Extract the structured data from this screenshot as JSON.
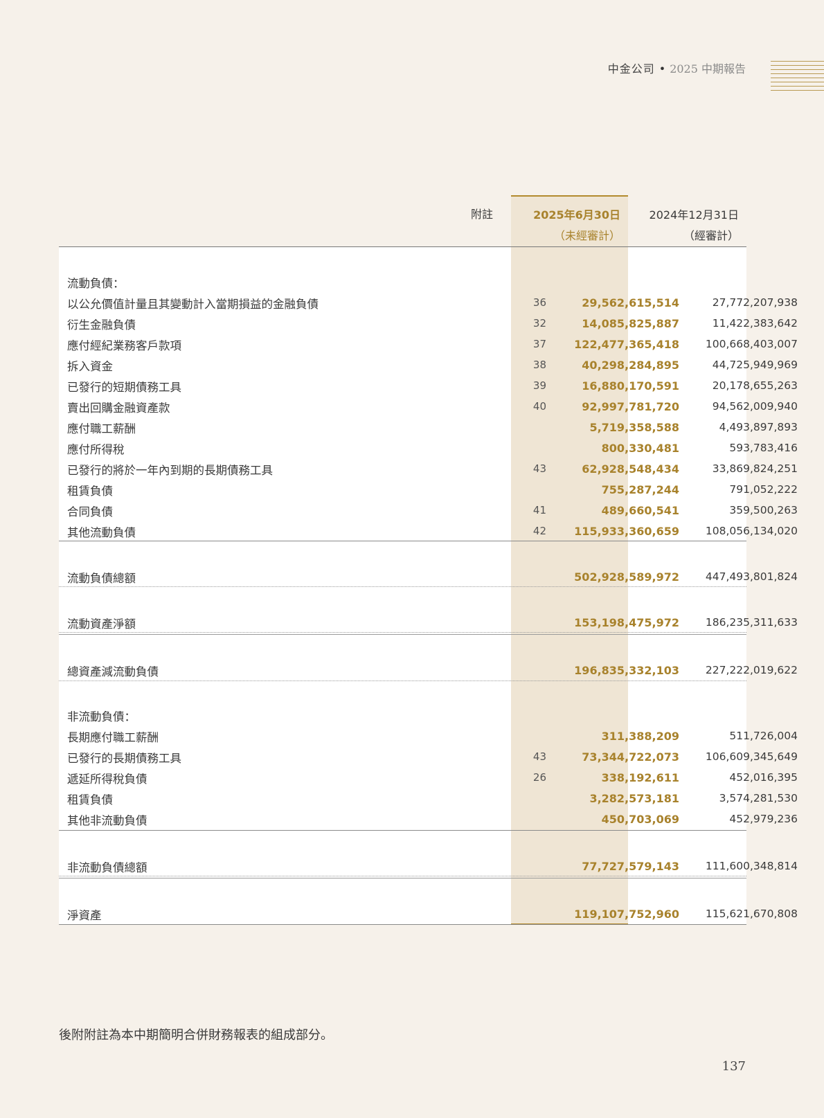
{
  "header": {
    "company": "中金公司",
    "separator": "•",
    "report": "2025 中期報告"
  },
  "columns": {
    "note": "附註",
    "current_date": "2025年6月30日",
    "current_status": "（未經審計）",
    "prior_date": "2024年12月31日",
    "prior_status": "（經審計）"
  },
  "sections": {
    "current_liabilities": "流動負債：",
    "non_current_liabilities": "非流動負債："
  },
  "current_rows": [
    {
      "label": "以公允價值計量且其變動計入當期損益的金融負債",
      "note": "36",
      "current": "29,562,615,514",
      "prior": "27,772,207,938"
    },
    {
      "label": "衍生金融負債",
      "note": "32",
      "current": "14,085,825,887",
      "prior": "11,422,383,642"
    },
    {
      "label": "應付經紀業務客戶款項",
      "note": "37",
      "current": "122,477,365,418",
      "prior": "100,668,403,007"
    },
    {
      "label": "拆入資金",
      "note": "38",
      "current": "40,298,284,895",
      "prior": "44,725,949,969"
    },
    {
      "label": "已發行的短期債務工具",
      "note": "39",
      "current": "16,880,170,591",
      "prior": "20,178,655,263"
    },
    {
      "label": "賣出回購金融資產款",
      "note": "40",
      "current": "92,997,781,720",
      "prior": "94,562,009,940"
    },
    {
      "label": "應付職工薪酬",
      "note": "",
      "current": "5,719,358,588",
      "prior": "4,493,897,893"
    },
    {
      "label": "應付所得稅",
      "note": "",
      "current": "800,330,481",
      "prior": "593,783,416"
    },
    {
      "label": "已發行的將於一年內到期的長期債務工具",
      "note": "43",
      "current": "62,928,548,434",
      "prior": "33,869,824,251"
    },
    {
      "label": "租賃負債",
      "note": "",
      "current": "755,287,244",
      "prior": "791,052,222"
    },
    {
      "label": "合同負債",
      "note": "41",
      "current": "489,660,541",
      "prior": "359,500,263"
    },
    {
      "label": "其他流動負債",
      "note": "42",
      "current": "115,933,360,659",
      "prior": "108,056,134,020"
    }
  ],
  "totals": {
    "current_total": {
      "label": "流動負債總額",
      "current": "502,928,589,972",
      "prior": "447,493,801,824"
    },
    "net_current_assets": {
      "label": "流動資產淨額",
      "current": "153,198,475,972",
      "prior": "186,235,311,633"
    },
    "total_assets_less_current": {
      "label": "總資產減流動負債",
      "current": "196,835,332,103",
      "prior": "227,222,019,622"
    },
    "non_current_total": {
      "label": "非流動負債總額",
      "current": "77,727,579,143",
      "prior": "111,600,348,814"
    },
    "net_assets": {
      "label": "淨資產",
      "current": "119,107,752,960",
      "prior": "115,621,670,808"
    }
  },
  "non_current_rows": [
    {
      "label": "長期應付職工薪酬",
      "note": "",
      "current": "311,388,209",
      "prior": "511,726,004"
    },
    {
      "label": "已發行的長期債務工具",
      "note": "43",
      "current": "73,344,722,073",
      "prior": "106,609,345,649"
    },
    {
      "label": "遞延所得稅負債",
      "note": "26",
      "current": "338,192,611",
      "prior": "452,016,395"
    },
    {
      "label": "租賃負債",
      "note": "",
      "current": "3,282,573,181",
      "prior": "3,574,281,530"
    },
    {
      "label": "其他非流動負債",
      "note": "",
      "current": "450,703,069",
      "prior": "452,979,236"
    }
  ],
  "footnote": "後附附註為本中期簡明合併財務報表的組成部分。",
  "page_number": "137",
  "colors": {
    "background": "#f6f1ea",
    "highlight": "#efe5d4",
    "accent": "#a8822c"
  }
}
